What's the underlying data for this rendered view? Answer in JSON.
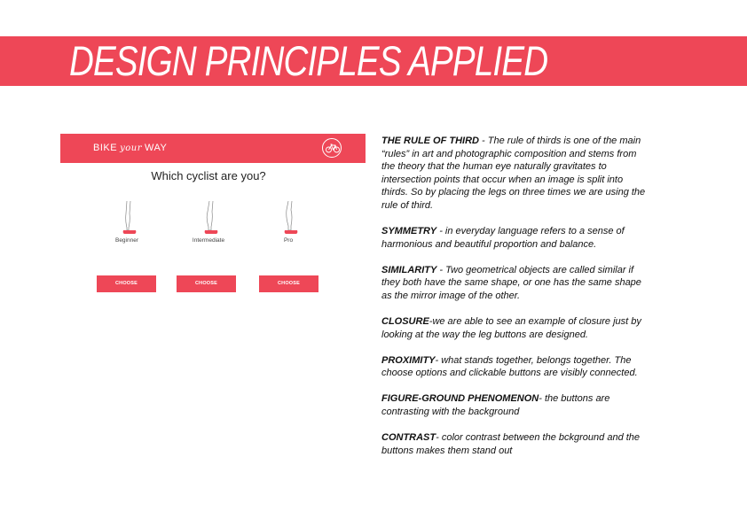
{
  "header": {
    "title": "DESIGN PRINCIPLES APPLIED"
  },
  "mockup": {
    "brand_left": "BIKE",
    "brand_script": "your",
    "brand_right": "WAY",
    "question": "Which cyclist are you?",
    "options": [
      {
        "label": "Beginner",
        "button": "CHOOSE"
      },
      {
        "label": "Intermediate",
        "button": "CHOOSE"
      },
      {
        "label": "Pro",
        "button": "CHOOSE"
      }
    ]
  },
  "principles": [
    {
      "term": "THE RULE OF THIRD",
      "text": " - The rule of thirds is one of the main “rules” in art and photographic composition and stems from the theory that the human eye naturally gravitates to intersection points that occur when an image is split into thirds. So by placing the legs on three times we are using the rule of third."
    },
    {
      "term": "SYMMETRY",
      "text": " - in everyday language refers to a sense of harmonious and beautiful proportion and balance."
    },
    {
      "term": "SIMILARITY",
      "text": " - Two geometrical objects are called similar if they both have the same shape, or one has the same shape as the mirror image of the other."
    },
    {
      "term": "CLOSURE",
      "text": "-we are able to see an example of closure just by looking at the way the leg buttons are designed."
    },
    {
      "term": "PROXIMITY",
      "text": "- what stands together, belongs together. The choose options and clickable buttons are visibly connected."
    },
    {
      "term": "FIGURE-GROUND PHENOMENON",
      "text": "- the buttons are contrasting with the background"
    },
    {
      "term": "CONTRAST",
      "text": "- color contrast between the bckground and the buttons makes them stand out"
    }
  ],
  "colors": {
    "accent": "#ee4757",
    "background": "#ffffff"
  },
  "icons": [
    "bicycle-icon",
    "leg-icon"
  ]
}
